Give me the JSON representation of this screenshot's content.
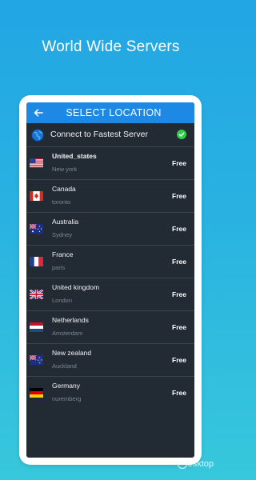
{
  "headline": "World Wide Servers",
  "appbar": {
    "title": "SELECT LOCATION",
    "back_icon": "arrow-left-icon"
  },
  "fastest": {
    "label": "Connect to Fastest Server",
    "icon": "globe-icon",
    "status_icon": "check-icon"
  },
  "servers": [
    {
      "country": "United_states",
      "city": "New york",
      "price": "Free",
      "flag": "us-flag-icon"
    },
    {
      "country": "Canada",
      "city": "toronto",
      "price": "Free",
      "flag": "canada-flag-icon"
    },
    {
      "country": "Australia",
      "city": "Sydney",
      "price": "Free",
      "flag": "australia-flag-icon"
    },
    {
      "country": "France",
      "city": "paris",
      "price": "Free",
      "flag": "france-flag-icon"
    },
    {
      "country": "United kingdom",
      "city": "London",
      "price": "Free",
      "flag": "uk-flag-icon"
    },
    {
      "country": "Netherlands",
      "city": "Amsterdam",
      "price": "Free",
      "flag": "netherlands-flag-icon"
    },
    {
      "country": "New zealand",
      "city": "Auckland",
      "price": "Free",
      "flag": "new-zealand-flag-icon"
    },
    {
      "country": "Germany",
      "city": "nuremberg",
      "price": "Free",
      "flag": "germany-flag-icon"
    }
  ],
  "colors": {
    "appbar": "#1e88e5",
    "screen_bg": "#222b33",
    "check": "#2fcf45"
  },
  "watermark": "esktop"
}
